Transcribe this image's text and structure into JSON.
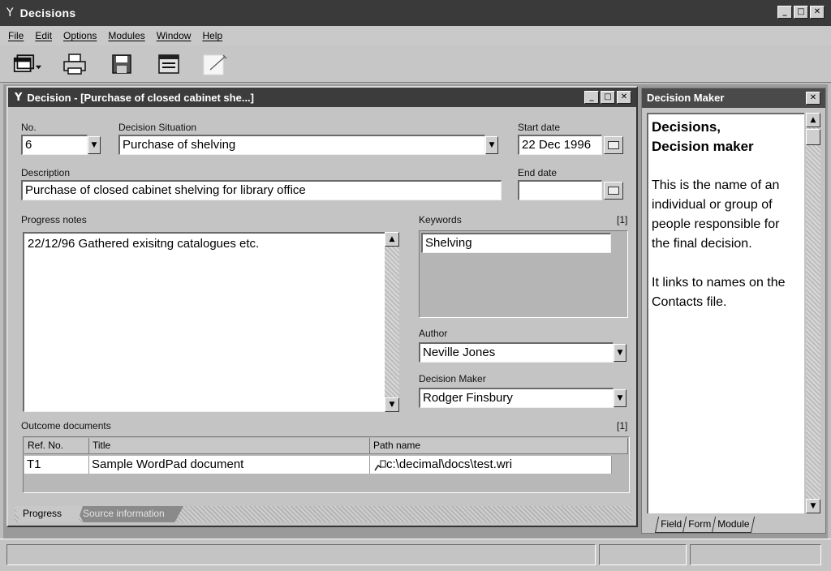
{
  "app": {
    "title": "Decisions",
    "icon": "Y"
  },
  "menu": [
    "File",
    "Edit",
    "Options",
    "Modules",
    "Window",
    "Help"
  ],
  "toolbar": [
    "window-menu-icon",
    "print-icon",
    "save-icon",
    "form-icon",
    "note-icon"
  ],
  "window": {
    "title": "Decision - [Purchase of closed cabinet she...]",
    "icon": "Y",
    "minimize": "_",
    "maximize": "□",
    "close": "✕"
  },
  "form": {
    "no_label": "No.",
    "no_value": "6",
    "situation_label": "Decision Situation",
    "situation_value": "Purchase of shelving",
    "start_label": "Start date",
    "start_value": "22 Dec 1996",
    "description_label": "Description",
    "description_value": "Purchase of closed cabinet shelving for library office",
    "end_label": "End date",
    "end_value": "",
    "notes_label": "Progress notes",
    "notes_value": "22/12/96 Gathered exisitng catalogues etc.",
    "keywords_label": "Keywords",
    "keywords_count": "[1]",
    "keywords_value": "Shelving",
    "author_label": "Author",
    "author_value": "Neville Jones",
    "maker_label": "Decision Maker",
    "maker_value": "Rodger Finsbury",
    "outcome_label": "Outcome documents",
    "outcome_count": "[1]"
  },
  "outcome_table": {
    "columns": [
      "Ref. No.",
      "Title",
      "Path name"
    ],
    "rows": [
      {
        "ref": "T1",
        "title": "Sample WordPad document",
        "path": "c:\\decimal\\docs\\test.wri"
      }
    ]
  },
  "tabs": [
    "Progress",
    "Source information"
  ],
  "panel": {
    "title": "Decision Maker",
    "heading_1": "Decisions,",
    "heading_2": "Decision maker",
    "para_1": "This is the name of an individual or group of people responsible for the final decision.",
    "para_2": "It links to names on the Contacts file.",
    "tabs": [
      "Field",
      "Form",
      "Module"
    ]
  },
  "colors": {
    "titlebar": "#3a3a3a",
    "face": "#c4c4c4",
    "window_bg": "#ffffff"
  }
}
